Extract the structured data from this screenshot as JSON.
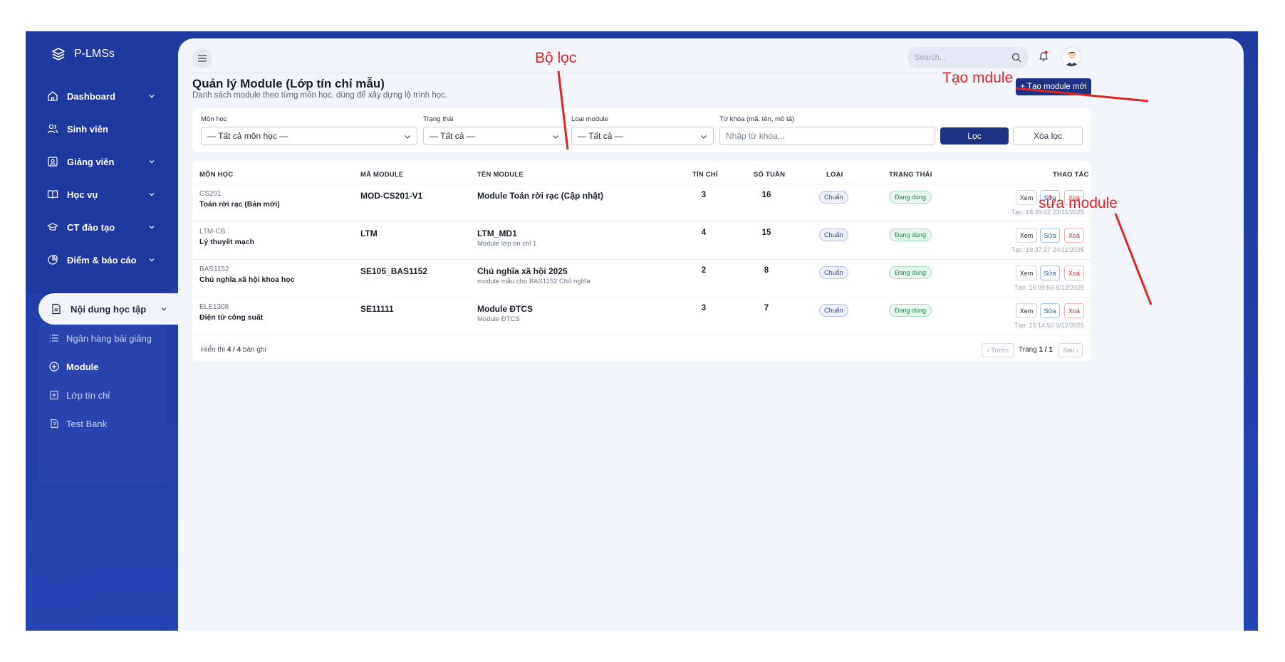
{
  "brand": {
    "name": "P-LMSs"
  },
  "sidebar": {
    "items": [
      {
        "label": "Dashboard"
      },
      {
        "label": "Sinh viên"
      },
      {
        "label": "Giảng viên"
      },
      {
        "label": "Học vụ"
      },
      {
        "label": "CT đào tạo"
      },
      {
        "label": "Điểm & báo cáo"
      },
      {
        "label": "Nội dung học tập"
      }
    ],
    "sub_items": [
      {
        "label": "Ngân hàng bài giảng"
      },
      {
        "label": "Module"
      },
      {
        "label": "Lớp tín chỉ"
      },
      {
        "label": "Test Bank"
      }
    ]
  },
  "header": {
    "search_placeholder": "Search...",
    "page_title": "Quản lý Module (Lớp tín chỉ mẫu)",
    "page_subtitle": "Danh sách module theo từng môn học, dùng để xây dựng lộ trình học.",
    "create_button": "+ Tạo module mới"
  },
  "filters": {
    "subject_label": "Môn học",
    "subject_value": "— Tất cả môn học —",
    "status_label": "Trạng thái",
    "status_value": "— Tất cả —",
    "type_label": "Loại module",
    "type_value": "— Tất cả —",
    "keyword_label": "Từ khóa (mã, tên, mô tả)",
    "keyword_placeholder": "Nhập từ khóa...",
    "filter_button": "Lọc",
    "clear_button": "Xóa lọc"
  },
  "table": {
    "headers": {
      "subject": "MÔN HỌC",
      "code": "MÃ MODULE",
      "name": "TÊN MODULE",
      "credits": "TÍN CHỈ",
      "weeks": "SỐ TUẦN",
      "type": "LOẠI",
      "status": "TRẠNG THÁI",
      "actions": "THAO TÁC"
    },
    "rows": [
      {
        "subject_code": "CS201",
        "subject_name": "Toán rời rạc (Bản mới)",
        "module_code": "MOD-CS201-V1",
        "module_name": "Module Toán rời rạc (Cập nhật)",
        "module_desc": "",
        "credits": "3",
        "weeks": "16",
        "type": "Chuẩn",
        "status": "Đang dùng",
        "created": "Tạo: 18:49:42 23/11/2025"
      },
      {
        "subject_code": "LTM-CB",
        "subject_name": "Lý thuyết mạch",
        "module_code": "LTM",
        "module_name": "LTM_MD1",
        "module_desc": "Module lớp tín chỉ 1",
        "credits": "4",
        "weeks": "15",
        "type": "Chuẩn",
        "status": "Đang dùng",
        "created": "Tạo: 19:37:27 24/11/2025"
      },
      {
        "subject_code": "BAS1152",
        "subject_name": "Chủ nghĩa xã hội khoa học",
        "module_code": "SE105_BAS1152",
        "module_name": "Chủ nghĩa xã hội 2025",
        "module_desc": "module mẫu cho BAS1152 Chủ nghĩa",
        "credits": "2",
        "weeks": "8",
        "type": "Chuẩn",
        "status": "Đang dùng",
        "created": "Tạo: 16:09:59 8/12/2025"
      },
      {
        "subject_code": "ELE1308",
        "subject_name": "Điện tử công suất",
        "module_code": "SE11111",
        "module_name": "Module ĐTCS",
        "module_desc": "Module ĐTCS",
        "credits": "3",
        "weeks": "7",
        "type": "Chuẩn",
        "status": "Đang dùng",
        "created": "Tạo: 15:14:50 9/12/2025"
      }
    ],
    "action_labels": {
      "view": "Xem",
      "edit": "Sửa",
      "delete": "Xoá"
    },
    "footer_prefix": "Hiển thị ",
    "footer_shown": "4 / 4",
    "footer_suffix": " bản ghi",
    "pager_prev": "‹ Trước",
    "pager_page_prefix": "Trang ",
    "pager_page": "1 / 1",
    "pager_next": "Sau ›"
  },
  "annotations": {
    "filter": "Bộ lọc",
    "create": "Tạo mdule",
    "edit": "sửa module"
  },
  "colors": {
    "sidebar_bg": "#1e3a9e",
    "primary_button": "#1d3282",
    "annotation_red": "#e02424",
    "status_green": "#1c8a4a"
  }
}
